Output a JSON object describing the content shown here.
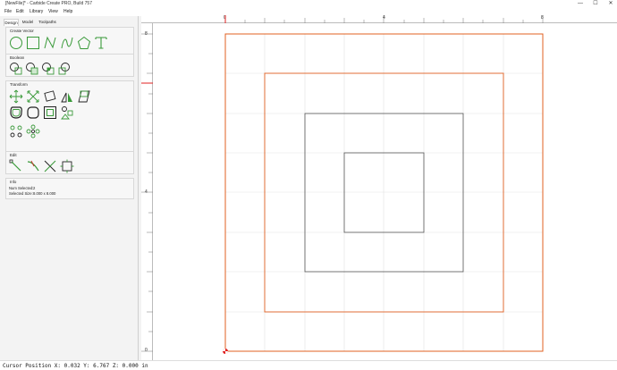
{
  "window": {
    "title": "[NewFile]* - Carbide Create PRO, Build 757",
    "minimize_glyph": "—",
    "maximize_glyph": "☐",
    "close_glyph": "✕"
  },
  "menu": [
    "File",
    "Edit",
    "Library",
    "View",
    "Help"
  ],
  "tabs": [
    "Design",
    "Model",
    "Toolpaths"
  ],
  "active_tab": "Design",
  "panels": {
    "create_vector": {
      "title": "Create Vector",
      "tools": [
        "circle-icon",
        "rectangle-icon",
        "polyline-icon",
        "curve-icon",
        "polygon-icon",
        "text-icon"
      ]
    },
    "boolean": {
      "title": "Boolean",
      "tools": [
        "union-icon",
        "subtract-icon",
        "intersect-icon",
        "weld-icon"
      ]
    },
    "transform": {
      "title": "Transform",
      "tools": [
        "move-icon",
        "scale-icon",
        "rotate-icon",
        "mirror-icon",
        "shear-icon",
        "offset-icon",
        "fillet-icon",
        "align-icon",
        "pattern-icon",
        "circle-pattern-icon",
        "grid-pattern-icon"
      ]
    },
    "edit": {
      "title": "Edit",
      "tools": [
        "node-edit-icon",
        "trim-icon",
        "cut-icon",
        "boundary-icon"
      ]
    },
    "info": {
      "title": "Info",
      "num_selected_label": "Num Selected:",
      "num_selected_value": "2",
      "selected_size_label": "Selected Size:",
      "selected_size_value": "8.000 x 8.000"
    }
  },
  "rulers": {
    "top_labels": [
      "0",
      "4",
      "8"
    ],
    "left_labels": [
      "8",
      "4",
      "0"
    ]
  },
  "status": {
    "text": "Cursor Position X: 0.032 Y: 6.767 Z: 0.000 in"
  },
  "colors": {
    "selection_orange": "#e06020",
    "inner_gray": "#555555",
    "grid": "#e2e2e2",
    "tool_green": "#3a9a3a",
    "origin_red": "#e02020"
  }
}
